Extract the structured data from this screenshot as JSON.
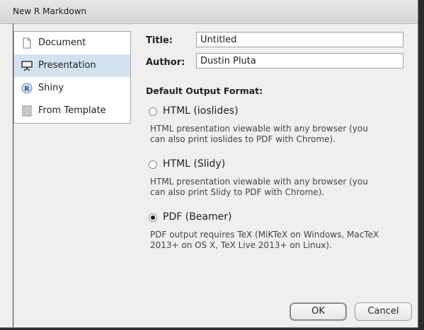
{
  "window": {
    "title": "New R Markdown"
  },
  "sidebar": {
    "items": [
      {
        "label": "Document",
        "icon": "document-icon",
        "selected": false
      },
      {
        "label": "Presentation",
        "icon": "presentation-icon",
        "selected": true
      },
      {
        "label": "Shiny",
        "icon": "shiny-r-icon",
        "selected": false
      },
      {
        "label": "From Template",
        "icon": "template-icon",
        "selected": false
      }
    ]
  },
  "form": {
    "title_label": "Title:",
    "title_value": "Untitled",
    "author_label": "Author:",
    "author_value": "Dustin Pluta"
  },
  "output": {
    "heading": "Default Output Format:",
    "options": [
      {
        "label": "HTML (ioslides)",
        "checked": false,
        "desc_line1": "HTML presentation viewable with any browser (you",
        "desc_line2": "can also print ioslides to PDF with Chrome)."
      },
      {
        "label": "HTML (Slidy)",
        "checked": false,
        "desc_line1": "HTML presentation viewable with any browser (you",
        "desc_line2": "can also print Slidy to PDF with Chrome)."
      },
      {
        "label": "PDF (Beamer)",
        "checked": true,
        "desc_line1": "PDF output requires TeX (MiKTeX on Windows, MacTeX",
        "desc_line2": "2013+ on OS X, TeX Live 2013+ on Linux)."
      }
    ]
  },
  "buttons": {
    "ok": "OK",
    "cancel": "Cancel"
  },
  "colors": {
    "selected_bg": "#d4e2f0",
    "dialog_bg": "#efefef"
  }
}
